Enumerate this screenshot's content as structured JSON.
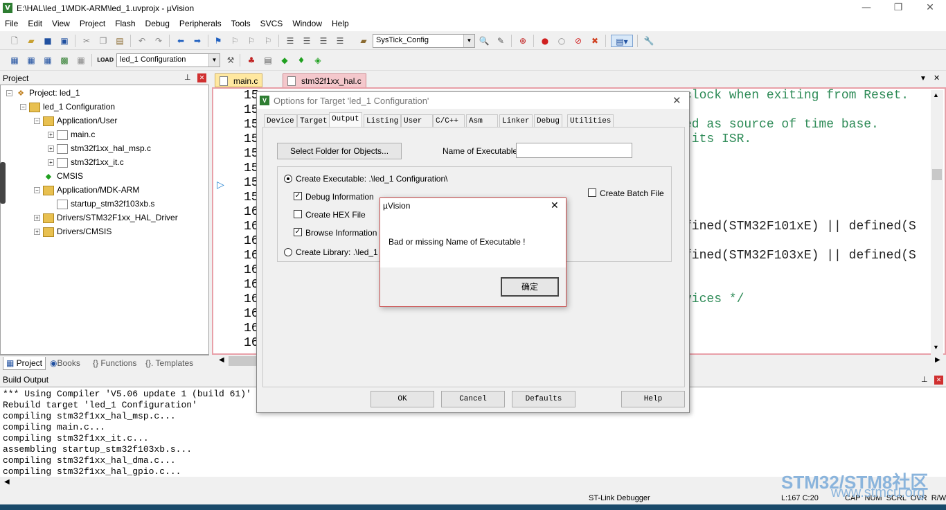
{
  "window": {
    "title": "E:\\HAL\\led_1\\MDK-ARM\\led_1.uvprojx - µVision",
    "minimize": "—",
    "maximize": "❐",
    "close": "✕"
  },
  "menu": [
    "File",
    "Edit",
    "View",
    "Project",
    "Flash",
    "Debug",
    "Peripherals",
    "Tools",
    "SVCS",
    "Window",
    "Help"
  ],
  "toolbar": {
    "function_combo": "SysTick_Config",
    "target_combo": "led_1 Configuration"
  },
  "project_pane": {
    "title": "Project",
    "tree": [
      {
        "label": "Project: led_1"
      },
      {
        "label": "led_1 Configuration"
      },
      {
        "label": "Application/User"
      },
      {
        "label": "main.c"
      },
      {
        "label": "stm32f1xx_hal_msp.c"
      },
      {
        "label": "stm32f1xx_it.c"
      },
      {
        "label": "CMSIS"
      },
      {
        "label": "Application/MDK-ARM"
      },
      {
        "label": "startup_stm32f103xb.s"
      },
      {
        "label": "Drivers/STM32F1xx_HAL_Driver"
      },
      {
        "label": "Drivers/CMSIS"
      }
    ],
    "tabs": [
      "Project",
      "Books",
      "{} Functions",
      "{}. Templates"
    ]
  },
  "editor": {
    "tabs": [
      "main.c",
      "stm32f1xx_hal.c"
    ],
    "line_numbers": [
      "15",
      "15",
      "15",
      "15",
      "15",
      "15",
      "15",
      "15",
      "16",
      "16",
      "16",
      "16",
      "16",
      "16",
      "16",
      "16",
      "16",
      "16"
    ],
    "code_lines": [
      "clock when exiting from Reset.",
      ".",
      "ed as source of time base.",
      " its ISR.",
      "",
      "",
      "",
      "",
      "",
      "fined(STM32F101xE) || defined(S",
      "",
      "fined(STM32F103xE) || defined(S",
      "",
      "",
      "vices */"
    ]
  },
  "build_output": {
    "title": "Build Output",
    "lines": [
      "*** Using Compiler 'V5.06 update 1 (build 61)'",
      "Rebuild target 'led_1 Configuration'",
      "compiling stm32f1xx_hal_msp.c...",
      "compiling main.c...",
      "compiling stm32f1xx_it.c...",
      "assembling startup_stm32f103xb.s...",
      "compiling stm32f1xx_hal_dma.c...",
      "compiling stm32f1xx_hal_gpio.c..."
    ]
  },
  "status": {
    "debugger": "ST-Link Debugger",
    "position": "L:167 C:20",
    "flags": "CAP  NUM  SCRL  OVR  R/W"
  },
  "options_dialog": {
    "title": "Options for Target 'led_1 Configuration'",
    "tabs": [
      "Device",
      "Target",
      "Output",
      "Listing",
      "User",
      "C/C++",
      "Asm",
      "Linker",
      "Debug",
      "Utilities"
    ],
    "select_folder_button": "Select Folder for Objects...",
    "name_label": "Name of Executable:",
    "name_value": "",
    "create_exe": "Create Executable: .\\led_1 Configuration\\",
    "debug_info": "Debug Information",
    "create_hex": "Create HEX File",
    "browse_info": "Browse Information",
    "create_lib": "Create Library: .\\led_1 Con",
    "create_batch": "Create Batch File",
    "buttons": {
      "ok": "OK",
      "cancel": "Cancel",
      "defaults": "Defaults",
      "help": "Help"
    }
  },
  "message_box": {
    "title": "µVision",
    "text": "Bad or missing Name of Executable !",
    "ok": "确定",
    "close": "✕"
  },
  "watermark": {
    "line1": "STM32/STM8社区",
    "line2": "www.stmcu.org"
  }
}
